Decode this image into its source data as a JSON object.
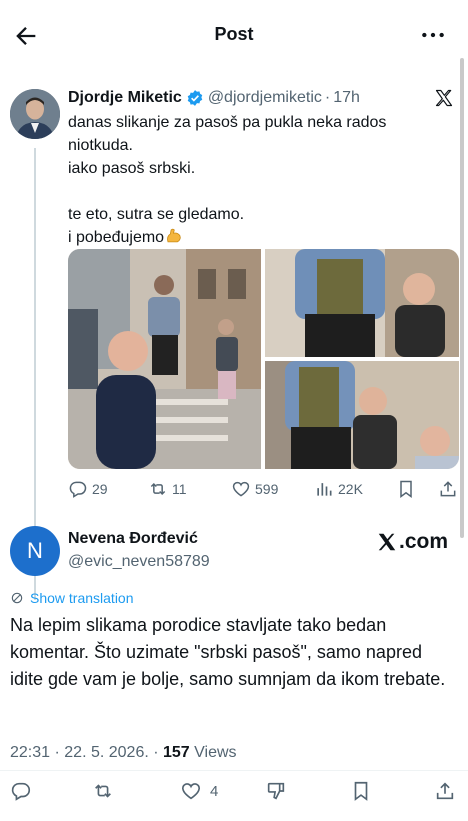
{
  "header": {
    "title": "Post"
  },
  "quoted_post": {
    "author": {
      "name": "Djordje Miketic",
      "handle": "@djordjemiketic",
      "time": "17h"
    },
    "text_lines": [
      "danas slikanje za pasoš pa pukla neka rados",
      "niotkuda.",
      "iako pasoš srbski.",
      "",
      "te eto, sutra se gledamo.",
      "i pobeđujemo"
    ],
    "emoji_icon": "flexed-biceps-icon",
    "stats": {
      "replies": "29",
      "reposts": "11",
      "likes": "599",
      "views": "22K"
    }
  },
  "reply": {
    "avatar_letter": "N",
    "name": "Nevena Đorđević",
    "handle": "@evic_neven58789",
    "source_label": ".com",
    "translate_label": "Show translation",
    "text": "Na lepim slikama porodice stavljate tako bedan komentar. Što uzimate \"srbski pasoš\", samo napred idite gde vam je bolje, samo sumnjam da ikom trebate.",
    "time": "22:31",
    "date": "22. 5. 2026.",
    "views_count": "157",
    "views_label": "Views",
    "likes": "4"
  },
  "colors": {
    "accent": "#1d9bf0",
    "secondary_text": "#536471",
    "avatar_bg": "#1d6fcc"
  }
}
